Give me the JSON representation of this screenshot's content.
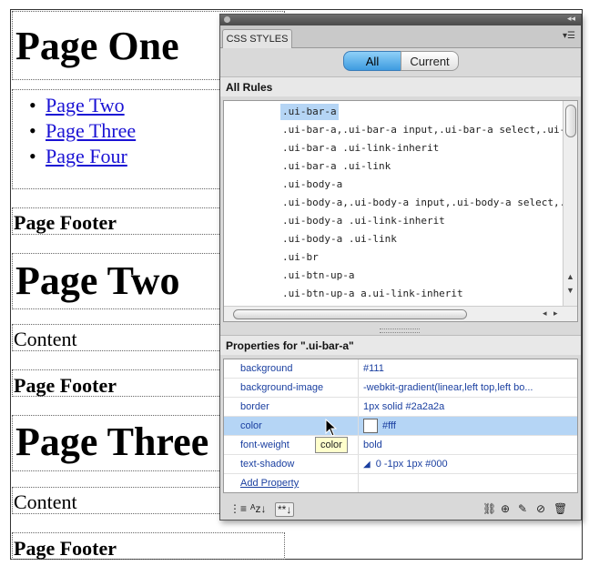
{
  "design": {
    "page_one": {
      "heading": "Page One",
      "links": [
        "Page Two",
        "Page Three",
        "Page Four"
      ],
      "footer": "Page Footer"
    },
    "page_two": {
      "heading": "Page Two",
      "content": "Content",
      "footer": "Page Footer"
    },
    "page_three": {
      "heading": "Page Three",
      "content": "Content",
      "footer": "Page Footer"
    }
  },
  "panel": {
    "tab_label": "CSS STYLES",
    "toggle": {
      "all_label": "All",
      "current_label": "Current",
      "selected": "All"
    },
    "all_rules_label": "All Rules",
    "rules": [
      ".ui-bar-a",
      ".ui-bar-a,.ui-bar-a input,.ui-bar-a select,.ui-bar-a t",
      ".ui-bar-a .ui-link-inherit",
      ".ui-bar-a .ui-link",
      ".ui-body-a",
      ".ui-body-a,.ui-body-a input,.ui-body-a select,.ui-boc",
      ".ui-body-a .ui-link-inherit",
      ".ui-body-a .ui-link",
      ".ui-br",
      ".ui-btn-up-a",
      ".ui-btn-up-a a.ui-link-inherit"
    ],
    "selected_rule": ".ui-bar-a",
    "properties_label": "Properties for \".ui-bar-a\"",
    "properties": [
      {
        "name": "background",
        "value": "#111"
      },
      {
        "name": "background-image",
        "value": "-webkit-gradient(linear,left top,left bo..."
      },
      {
        "name": "border",
        "value": "1px solid #2a2a2a"
      },
      {
        "name": "color",
        "value": "#fff"
      },
      {
        "name": "font-weight",
        "value": "bold"
      },
      {
        "name": "text-shadow",
        "value": "0 -1px 1px #000"
      }
    ],
    "add_property_label": "Add Property",
    "tooltip": "color",
    "colors": {
      "selection": "#b5d5f5",
      "toggle_active": "#3e9be0",
      "link": "#1a12d4",
      "property_text": "#1a3fa0"
    },
    "bottom_icons": [
      "show-category-view-icon",
      "show-alphabetical-view-icon",
      "show-set-properties-icon",
      "attach-style-sheet-icon",
      "new-css-rule-icon",
      "edit-rule-icon",
      "disable-property-icon",
      "delete-icon"
    ]
  }
}
